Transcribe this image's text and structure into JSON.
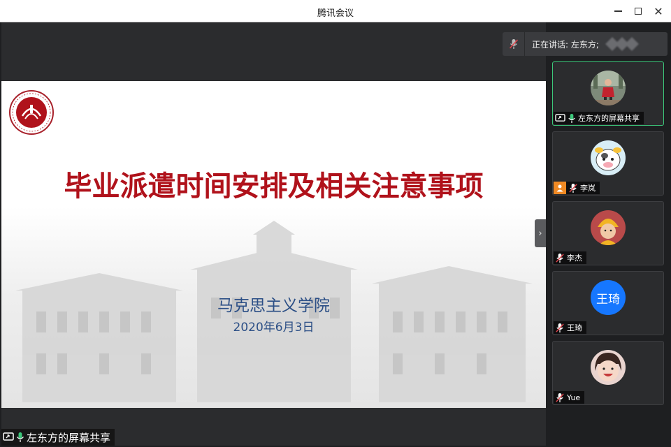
{
  "window": {
    "title": "腾讯会议"
  },
  "speaking": {
    "text": "正在讲话: 左东方;"
  },
  "slide": {
    "title": "毕业派遣时间安排及相关注意事项",
    "org": "马克思主义学院",
    "date": "2020年6月3日"
  },
  "share_tag": {
    "label": "左东方的屏幕共享"
  },
  "participants": [
    {
      "name": "左东方的屏幕共享",
      "avatar": "photo-girl-icon",
      "mic": "on",
      "sharing": true,
      "active": true
    },
    {
      "name": "李岚",
      "avatar": "cartoon-cow-icon",
      "mic": "muted",
      "badge": "person-icon"
    },
    {
      "name": "李杰",
      "avatar": "photo-child-hat-icon",
      "mic": "muted"
    },
    {
      "name": "王琦",
      "avatar_text": "王琦",
      "avatar_color": "#1677ff",
      "mic": "muted"
    },
    {
      "name": "Yue",
      "avatar": "photo-child-smile-icon",
      "mic": "muted"
    }
  ],
  "colors": {
    "accent_green": "#3cc77a",
    "title_red": "#b0121b",
    "org_blue": "#2c4f86",
    "avatar_blue": "#1677ff",
    "badge_orange": "#f08a24"
  }
}
